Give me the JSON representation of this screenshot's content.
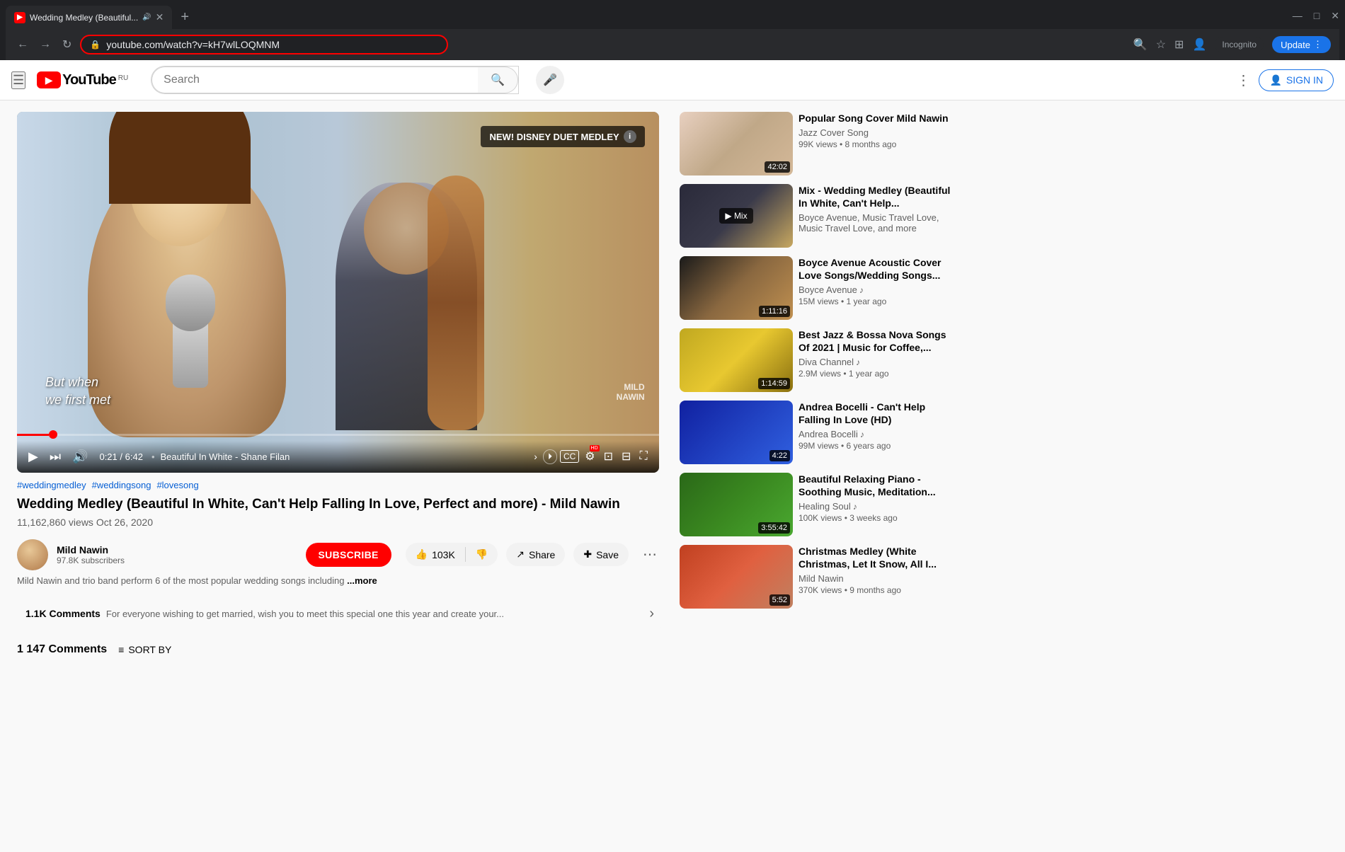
{
  "browser": {
    "tab_title": "Wedding Medley (Beautiful...",
    "tab_favicon": "▶",
    "tab_audio_icon": "🔊",
    "url": "youtube.com/watch?v=kH7wlLOQMNM",
    "new_tab_icon": "+",
    "win_minimize": "—",
    "win_maximize": "□",
    "win_close": "✕",
    "nav_back": "←",
    "nav_forward": "→",
    "nav_refresh": "↻",
    "lock_icon": "🔒",
    "search_icon": "🔍",
    "bookmark_icon": "☆",
    "extensions_icon": "⊞",
    "profile_icon": "👤",
    "incognito_label": "Incognito",
    "update_label": "Update",
    "more_icon": "⋮"
  },
  "youtube": {
    "logo_text": "YouTube",
    "logo_region": "RU",
    "search_placeholder": "Search",
    "search_icon": "🔍",
    "mic_icon": "🎤",
    "more_options_icon": "⋮",
    "sign_in_label": "SIGN IN",
    "menu_icon": "☰"
  },
  "video": {
    "badge_text": "NEW! DISNEY DUET MEDLEY",
    "overlay_line1": "But when",
    "overlay_line2": "we first met",
    "watermark_line1": "MILD",
    "watermark_line2": "NAWIN",
    "time_current": "0:21",
    "time_total": "6:42",
    "chapter_title": "Beautiful In White - Shane Filan",
    "progress_percent": 5,
    "hashtags": [
      "#weddingmedley",
      "#weddingsong",
      "#lovesong"
    ],
    "title": "Wedding Medley (Beautiful In White, Can't Help Falling In Love, Perfect and more) - Mild Nawin",
    "views": "11,162,860 views",
    "upload_date": "Oct 26, 2020",
    "description_preview": "Mild Nawin and trio band perform 6 of the most popular wedding songs including",
    "more_link": "...more",
    "like_count": "103K",
    "like_icon": "👍",
    "dislike_label": "Dislike",
    "dislike_icon": "👎",
    "share_label": "Share",
    "share_icon": "↗",
    "save_label": "Save",
    "save_icon": "✚",
    "more_actions_icon": "⋯",
    "channel_name": "Mild Nawin",
    "channel_subs": "97.8K subscribers",
    "subscribe_label": "SUBSCRIBE",
    "comments_count": "1.1K",
    "comments_label": "Comments",
    "comments_preview_text": "For everyone wishing to get married, wish you to meet this special one this year and create your...",
    "comments_arrow": "›",
    "comments_total_label": "1 147 Comments",
    "sort_by_label": "SORT BY"
  },
  "controls": {
    "play_icon": "▶",
    "next_icon": "⏭",
    "volume_icon": "🔊",
    "miniplayer_icon": "⊡",
    "theater_icon": "⊞",
    "fullscreen_icon": "⛶",
    "subtitles_icon": "CC",
    "settings_icon": "⚙",
    "hd_badge": "HD"
  },
  "sidebar": {
    "videos": [
      {
        "title": "Popular Song Cover Mild Nawin",
        "channel": "Jazz Cover Song",
        "meta": "99K views • 8 months ago",
        "duration": "42:02",
        "thumb_class": "thumb-1",
        "channel_verified": false
      },
      {
        "title": "Mix - Wedding Medley (Beautiful In White, Can't Help...",
        "channel": "Boyce Avenue, Music Travel Love, Music Travel Love, and more",
        "meta": "",
        "duration": "",
        "thumb_class": "thumb-2",
        "has_play": true,
        "channel_verified": false
      },
      {
        "title": "Boyce Avenue Acoustic Cover Love Songs/Wedding Songs...",
        "channel": "Boyce Avenue",
        "meta": "15M views • 1 year ago",
        "duration": "1:11:16",
        "thumb_class": "thumb-3",
        "channel_verified": true
      },
      {
        "title": "Best Jazz & Bossa Nova Songs Of 2021 | Music for Coffee,...",
        "channel": "Diva Channel",
        "meta": "2.9M views • 1 year ago",
        "duration": "1:14:59",
        "thumb_class": "thumb-4",
        "channel_verified": true
      },
      {
        "title": "Andrea Bocelli - Can't Help Falling In Love (HD)",
        "channel": "Andrea Bocelli",
        "meta": "99M views • 6 years ago",
        "duration": "4:22",
        "thumb_class": "thumb-5",
        "channel_verified": true
      },
      {
        "title": "Beautiful Relaxing Piano - Soothing Music, Meditation...",
        "channel": "Healing Soul",
        "meta": "100K views • 3 weeks ago",
        "duration": "3:55:42",
        "thumb_class": "thumb-6",
        "channel_verified": true
      },
      {
        "title": "Christmas Medley (White Christmas, Let It Snow, All I...",
        "channel": "Mild Nawin",
        "meta": "370K views • 9 months ago",
        "duration": "5:52",
        "thumb_class": "thumb-7",
        "channel_verified": false
      }
    ]
  }
}
